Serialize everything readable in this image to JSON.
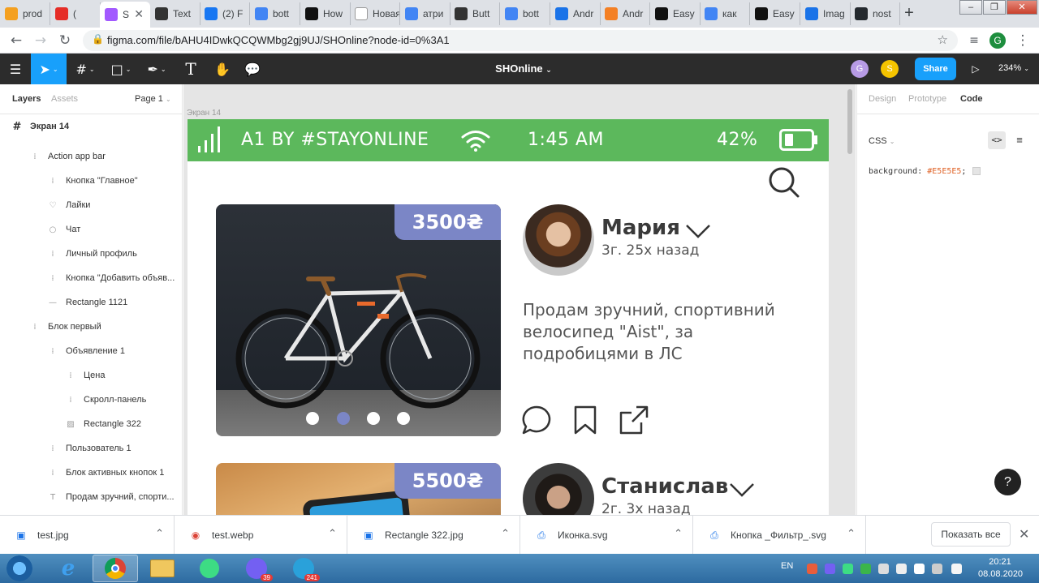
{
  "browser": {
    "tabs": [
      {
        "title": "prod",
        "color": "#f4a020"
      },
      {
        "title": "(",
        "color": "#e52d27"
      },
      {
        "title": "S",
        "color": "#a259ff",
        "active": true
      },
      {
        "title": "Text",
        "color": "#333333"
      },
      {
        "title": "(2) F",
        "color": "#1877f2"
      },
      {
        "title": "bott",
        "color": "#4285f4"
      },
      {
        "title": "How",
        "color": "#111111"
      },
      {
        "title": "Новая вк",
        "color": "#ffffff"
      },
      {
        "title": "атри",
        "color": "#4285f4"
      },
      {
        "title": "Butt",
        "color": "#333333"
      },
      {
        "title": "bott",
        "color": "#4285f4"
      },
      {
        "title": "Andr",
        "color": "#1a73e8"
      },
      {
        "title": "Andr",
        "color": "#f48024"
      },
      {
        "title": "Easy",
        "color": "#111111"
      },
      {
        "title": "как",
        "color": "#4285f4"
      },
      {
        "title": "Easy",
        "color": "#111111"
      },
      {
        "title": "Imag",
        "color": "#1a73e8"
      },
      {
        "title": "nost",
        "color": "#24292e"
      }
    ],
    "url": "figma.com/file/bAHU4IDwkQCQWMbg2gj9UJ/SHOnline?node-id=0%3A1",
    "profile_initial": "G"
  },
  "figma": {
    "doc_title": "SHOnline",
    "zoom": "234%",
    "share_label": "Share",
    "avatars": [
      {
        "initial": "G",
        "color": "#b79be5"
      },
      {
        "initial": "S",
        "color": "#f5c400"
      }
    ],
    "left_panel": {
      "tabs": [
        "Layers",
        "Assets"
      ],
      "page": "Page 1",
      "frame_name": "Экран 14",
      "layers": [
        {
          "name": "Action app bar",
          "icon": "frame-icon",
          "indent": 1
        },
        {
          "name": "Кнопка \"Главное\"",
          "icon": "frame-icon",
          "indent": 2
        },
        {
          "name": "Лайки",
          "icon": "heart-icon",
          "indent": 2
        },
        {
          "name": "Чат",
          "icon": "chat-icon",
          "indent": 2
        },
        {
          "name": "Личный профиль",
          "icon": "frame-icon",
          "indent": 2
        },
        {
          "name": "Кнопка \"Добавить объяв...",
          "icon": "frame-icon",
          "indent": 2
        },
        {
          "name": "Rectangle 1121",
          "icon": "line-icon",
          "indent": 2
        },
        {
          "name": "Блок первый",
          "icon": "frame-icon",
          "indent": 1
        },
        {
          "name": "Объявление 1",
          "icon": "frame-icon",
          "indent": 2
        },
        {
          "name": "Цена",
          "icon": "frame-icon",
          "indent": 3
        },
        {
          "name": "Скролл-панель",
          "icon": "frame-icon",
          "indent": 3
        },
        {
          "name": "Rectangle 322",
          "icon": "image-icon",
          "indent": 3
        },
        {
          "name": "Пользователь 1",
          "icon": "frame-icon",
          "indent": 2
        },
        {
          "name": "Блок активных кнопок 1",
          "icon": "frame-icon",
          "indent": 2
        },
        {
          "name": "Продам зручний, спорти...",
          "icon": "text-icon",
          "indent": 2
        }
      ]
    },
    "right_panel": {
      "tabs": [
        "Design",
        "Prototype",
        "Code"
      ],
      "active_tab": "Code",
      "css_label": "CSS",
      "css_property": "background:",
      "css_value": "#E5E5E5",
      "css_semicolon": ";",
      "help": "?"
    },
    "canvas": {
      "frame_label": "Экран 14",
      "status_bar": {
        "operator": "A1 BY #STAYONLINE",
        "time": "1:45 AM",
        "battery": "42%"
      },
      "posts": [
        {
          "price": "3500₴",
          "user": "Мария",
          "time": "3г. 25х назад",
          "description": "Продам зручний, спортивний велосипед \"Aist\", за подробицями в ЛС",
          "active_dot": 1
        },
        {
          "price": "5500₴",
          "user": "Станислав",
          "time": "2г. 3х назад"
        }
      ]
    }
  },
  "downloads": {
    "items": [
      {
        "name": "test.jpg",
        "icon": "image-file-icon"
      },
      {
        "name": "test.webp",
        "icon": "chrome-icon"
      },
      {
        "name": "Rectangle 322.jpg",
        "icon": "image-file-icon"
      },
      {
        "name": "Иконка.svg",
        "icon": "svg-file-icon"
      },
      {
        "name": "Кнопка _Фильтр_.svg",
        "icon": "svg-file-icon"
      }
    ],
    "show_all": "Показать все"
  },
  "taskbar": {
    "lang": "EN",
    "time": "20:21",
    "date": "08.08.2020",
    "badges": {
      "viber": "39",
      "telegram": "241"
    }
  }
}
